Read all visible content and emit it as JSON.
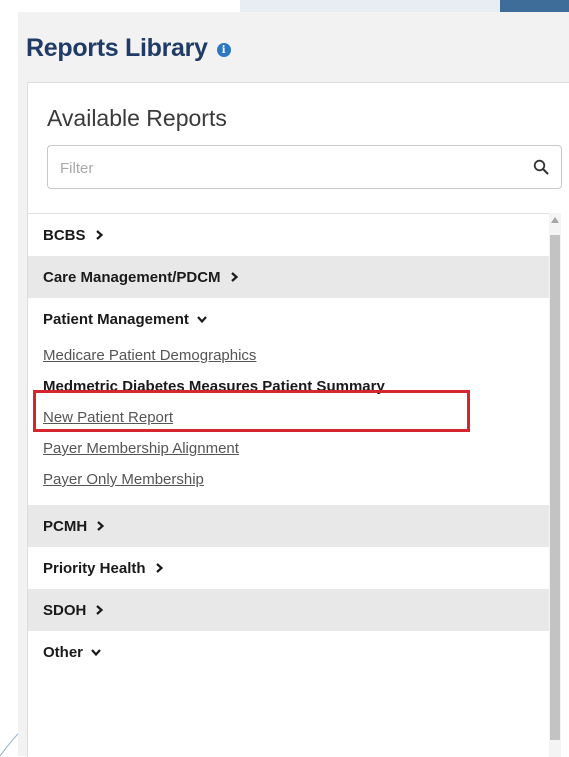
{
  "library": {
    "title": "Reports Library",
    "info_icon": "info-circle-icon"
  },
  "panel": {
    "title": "Available Reports",
    "filter": {
      "placeholder": "Filter",
      "value": "",
      "icon": "search-icon"
    }
  },
  "categories": [
    {
      "label": "BCBS",
      "state": "collapsed"
    },
    {
      "label": "Care Management/PDCM",
      "state": "collapsed"
    },
    {
      "label": "Patient Management",
      "state": "expanded",
      "reports": [
        {
          "label": "Medicare Patient Demographics"
        },
        {
          "label": "Medmetric Diabetes Measures Patient Summary",
          "highlighted": true
        },
        {
          "label": "New Patient Report"
        },
        {
          "label": "Payer Membership Alignment"
        },
        {
          "label": "Payer Only Membership"
        }
      ]
    },
    {
      "label": "PCMH",
      "state": "collapsed"
    },
    {
      "label": "Priority Health",
      "state": "collapsed"
    },
    {
      "label": "SDOH",
      "state": "collapsed"
    },
    {
      "label": "Other",
      "state": "expanded"
    }
  ],
  "colors": {
    "title": "#1f3b66",
    "highlight": "#d6262d",
    "info": "#2d78c6"
  }
}
